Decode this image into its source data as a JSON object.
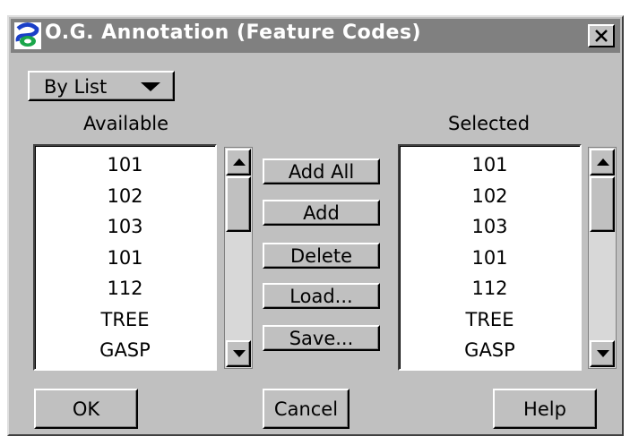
{
  "window": {
    "title": "O.G. Annotation (Feature Codes)",
    "close_glyph": "✕"
  },
  "mode_dropdown": {
    "selected": "By List"
  },
  "available": {
    "label": "Available",
    "items": [
      "101",
      "102",
      "103",
      "101",
      "112",
      "TREE",
      "GASP"
    ]
  },
  "selected": {
    "label": "Selected",
    "items": [
      "101",
      "102",
      "103",
      "101",
      "112",
      "TREE",
      "GASP"
    ]
  },
  "actions": {
    "add_all": "Add All",
    "add": "Add",
    "delete": "Delete",
    "load": "Load...",
    "save": "Save..."
  },
  "footer": {
    "ok": "OK",
    "cancel": "Cancel",
    "help": "Help"
  },
  "icons": {
    "app": "app-logo-icon",
    "close": "close-icon",
    "dropdown": "triangle-down-icon",
    "scroll_up": "scroll-up-icon",
    "scroll_down": "scroll-down-icon"
  },
  "colors": {
    "dialog_face": "#c0c0c0",
    "titlebar": "#808080",
    "list_bg": "#ffffff",
    "icon_blue": "#1a3fc7",
    "icon_green": "#1aa64a"
  }
}
